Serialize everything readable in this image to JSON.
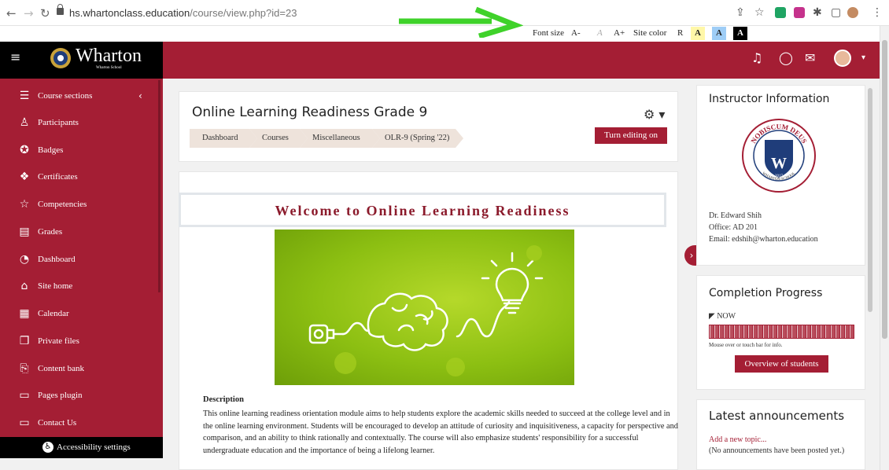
{
  "browser": {
    "url_host": "hs.whartonclass.education",
    "url_path": "/course/view.php?id=23"
  },
  "a11y_bar": {
    "font_size_label": "Font size",
    "decrease": "A-",
    "reset": "A",
    "increase": "A+",
    "site_color_label": "Site color",
    "reset_color": "R",
    "colors": [
      {
        "label": "A",
        "bg": "#fff7a8",
        "fg": "#333"
      },
      {
        "label": "A",
        "bg": "#9ecdf6",
        "fg": "#333"
      },
      {
        "label": "A",
        "bg": "#000000",
        "fg": "#ffffff"
      }
    ]
  },
  "brand": {
    "name": "Wharton",
    "sub": "Wharton School"
  },
  "sidebar": {
    "items": [
      {
        "label": "Course sections",
        "icon": "list-icon"
      },
      {
        "label": "Participants",
        "icon": "users-icon"
      },
      {
        "label": "Badges",
        "icon": "badge-icon"
      },
      {
        "label": "Certificates",
        "icon": "certificate-icon"
      },
      {
        "label": "Competencies",
        "icon": "star-icon"
      },
      {
        "label": "Grades",
        "icon": "grades-icon"
      },
      {
        "label": "Dashboard",
        "icon": "dashboard-icon"
      },
      {
        "label": "Site home",
        "icon": "home-icon"
      },
      {
        "label": "Calendar",
        "icon": "calendar-icon"
      },
      {
        "label": "Private files",
        "icon": "files-icon"
      },
      {
        "label": "Content bank",
        "icon": "content-bank-icon"
      },
      {
        "label": "Pages plugin",
        "icon": "folder-icon"
      },
      {
        "label": "Contact Us",
        "icon": "folder-icon"
      }
    ],
    "footer": "Accessibility settings"
  },
  "course": {
    "title": "Online Learning Readiness Grade 9",
    "breadcrumbs": [
      "Dashboard",
      "Courses",
      "Miscellaneous",
      "OLR-9 (Spring '22)"
    ],
    "turn_editing": "Turn editing on",
    "welcome": "Welcome to Online Learning Readiness",
    "description_heading": "Description",
    "description": "This online learning readiness orientation module aims to help students explore the academic skills needed to succeed at the college level and in the online learning environment. Students will be encouraged to develop an attitude of curiosity and inquisitiveness, a capacity for perspective and comparison, and an ability to think rationally and contextually. The course will also emphasize students' responsibility for a successful undergraduate education and the importance of being a lifelong learner."
  },
  "instructor": {
    "title": "Instructor Information",
    "seal_top": "NOBISCUM DEUS",
    "seal_bottom": "WHARTON SCHOOL",
    "seal_letter": "W",
    "seal_year": "2017",
    "name": "Dr. Edward Shih",
    "office": "Office: AD 201",
    "email": "Email: edshih@wharton.education"
  },
  "completion": {
    "title": "Completion Progress",
    "now": "NOW",
    "hint": "Mouse over or touch bar for info.",
    "button": "Overview of students",
    "segments": 30
  },
  "announcements": {
    "title": "Latest announcements",
    "add": "Add a new topic...",
    "none": "(No announcements have been posted yet.)"
  }
}
